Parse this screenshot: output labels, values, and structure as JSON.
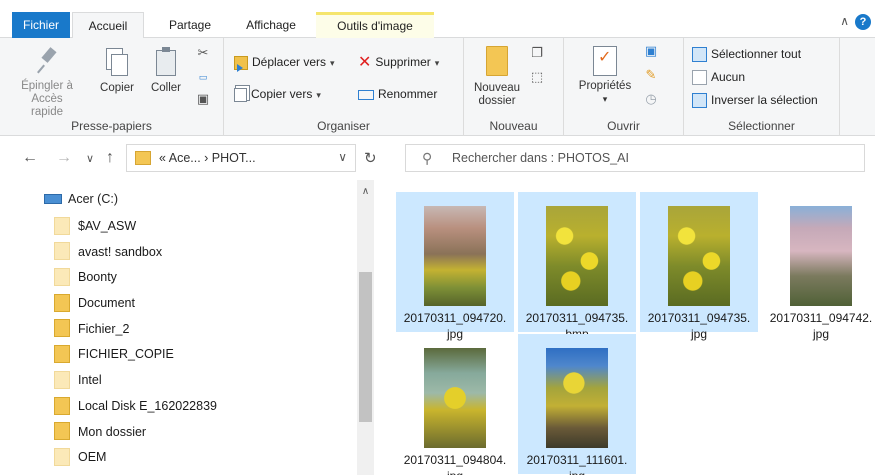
{
  "tabs": {
    "file": "Fichier",
    "home": "Accueil",
    "share": "Partage",
    "view": "Affichage",
    "picture_tools": "Outils d'image"
  },
  "ribbon": {
    "clipboard": {
      "pin_line1": "Épingler à",
      "pin_line2": "Accès rapide",
      "copy": "Copier",
      "paste": "Coller",
      "label": "Presse-papiers"
    },
    "organize": {
      "move_to": "Déplacer vers",
      "copy_to": "Copier vers",
      "delete": "Supprimer",
      "rename": "Renommer",
      "label": "Organiser"
    },
    "new": {
      "folder_line1": "Nouveau",
      "folder_line2": "dossier",
      "label": "Nouveau"
    },
    "open": {
      "properties": "Propriétés",
      "label": "Ouvrir"
    },
    "select": {
      "select_all": "Sélectionner tout",
      "select_none": "Aucun",
      "invert": "Inverser la sélection",
      "label": "Sélectionner"
    }
  },
  "address": {
    "path": "« Ace... › PHOT...",
    "search_placeholder": "Rechercher dans : PHOTOS_AI"
  },
  "nav": {
    "drive": "Acer (C:)",
    "folders": [
      {
        "name": "$AV_ASW",
        "style": "pale"
      },
      {
        "name": "avast! sandbox",
        "style": "pale"
      },
      {
        "name": "Boonty",
        "style": "pale"
      },
      {
        "name": "Document",
        "style": "solid"
      },
      {
        "name": "Fichier_2",
        "style": "solid"
      },
      {
        "name": "FICHIER_COPIE",
        "style": "solid"
      },
      {
        "name": "Intel",
        "style": "pale"
      },
      {
        "name": "Local Disk E_162022839",
        "style": "solid"
      },
      {
        "name": "Mon dossier",
        "style": "solid"
      },
      {
        "name": "OEM",
        "style": "pale"
      }
    ]
  },
  "files": [
    {
      "line1": "20170311_094720.",
      "line2": "jpg",
      "selected": true,
      "photo": "blossom"
    },
    {
      "line1": "20170311_094735.",
      "line2": "bmp",
      "selected": true,
      "photo": "mimosa"
    },
    {
      "line1": "20170311_094735.",
      "line2": "jpg",
      "selected": true,
      "photo": "mimosa"
    },
    {
      "line1": "20170311_094742.",
      "line2": "jpg",
      "selected": false,
      "photo": "pink"
    },
    {
      "line1": "20170311_094804.",
      "line2": "jpg",
      "selected": false,
      "photo": "succ"
    },
    {
      "line1": "20170311_111601.",
      "line2": "jpg",
      "selected": true,
      "photo": "sky"
    }
  ],
  "colors": {
    "file_tab": "#1979ca",
    "selection": "#cce8ff",
    "folder": "#f3c654"
  }
}
